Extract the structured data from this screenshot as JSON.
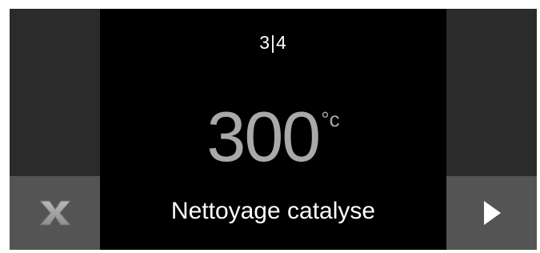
{
  "display": {
    "step_indicator": "3|4",
    "temperature_value": "300",
    "temperature_unit": "°c",
    "program_name": "Nettoyage catalyse"
  },
  "buttons": {
    "cancel_icon": "close-icon",
    "next_icon": "play-right-icon"
  },
  "colors": {
    "background": "#000000",
    "side_column": "#2b2b2b",
    "button": "#545454",
    "temperature": "#a9a9a9",
    "text": "#ffffff"
  }
}
